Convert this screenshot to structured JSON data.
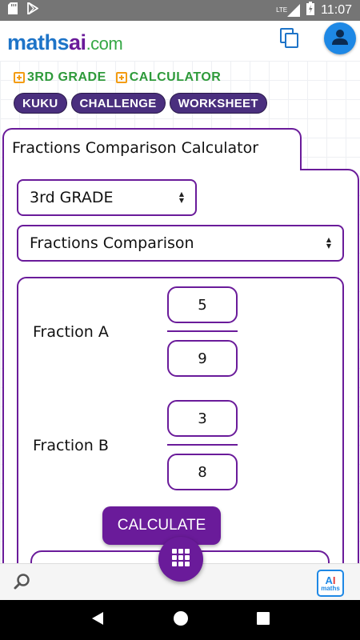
{
  "status_bar": {
    "time": "11:07",
    "network": "LTE"
  },
  "header": {
    "logo": {
      "part1": "maths",
      "part2": "ai",
      "part3": ".com"
    }
  },
  "breadcrumbs": [
    "3RD GRADE",
    "CALCULATOR"
  ],
  "pills": [
    "KUKU",
    "CHALLENGE",
    "WORKSHEET"
  ],
  "calculator": {
    "title": "Fractions Comparison Calculator",
    "grade_select": "3rd GRADE",
    "type_select": "Fractions Comparison",
    "fraction_a": {
      "label": "Fraction A",
      "numerator": "5",
      "denominator": "9"
    },
    "fraction_b": {
      "label": "Fraction B",
      "numerator": "3",
      "denominator": "8"
    },
    "calculate_label": "CALCULATE"
  },
  "bottom_bar": {
    "app_logo": {
      "line1_a": "A",
      "line1_b": "I",
      "line2": "maths"
    }
  },
  "colors": {
    "accent": "#6a1b9a",
    "brand_blue": "#1e74c8",
    "crumb_green": "#2e9a3a",
    "status_bar": "#757575"
  },
  "icons": [
    "sd-card-icon",
    "play-store-icon",
    "signal-icon",
    "battery-icon",
    "copy-icon",
    "account-icon",
    "search-icon",
    "grid-icon",
    "back-icon",
    "home-icon",
    "recents-icon"
  ]
}
